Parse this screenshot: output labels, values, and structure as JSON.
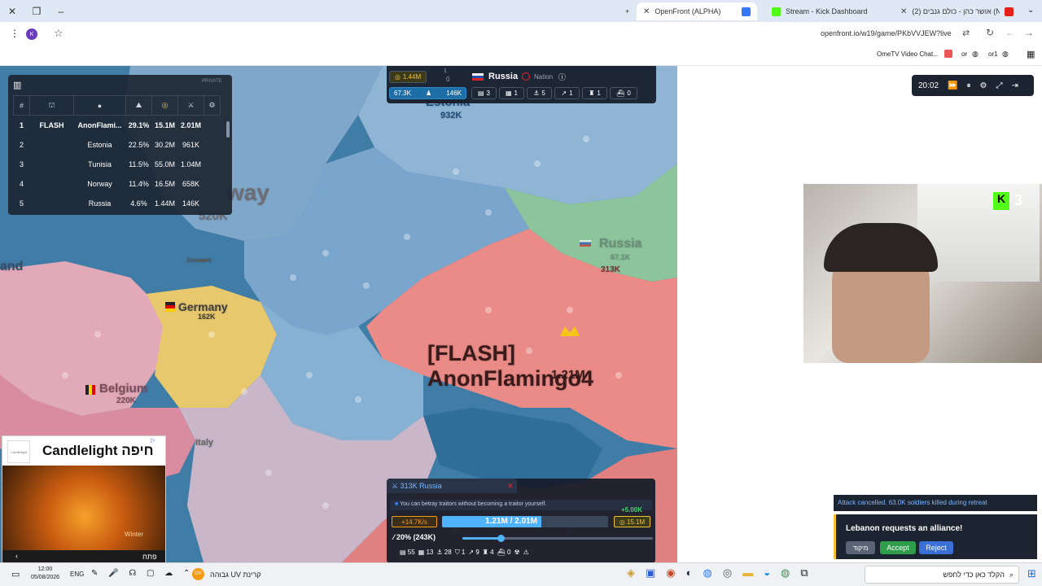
{
  "browser": {
    "tabs": [
      {
        "title": "OpenFront (ALPHA)",
        "active": true
      },
      {
        "title": "Stream - Kick Dashboard",
        "active": false
      },
      {
        "title": "(2) אושר כהן - כולם גנבים (Nuri)",
        "active": false
      }
    ],
    "url": "openfront.io/w19/game/PKbVVJEW?live",
    "bookmarks": [
      "OmeTV Video Chat...",
      "or",
      "or1"
    ]
  },
  "leaderboard": {
    "header_right": "PRIVATE",
    "columns": [
      "#",
      "",
      "",
      "",
      "",
      "",
      ""
    ],
    "rows": [
      {
        "rank": "1",
        "clan": "FLASH",
        "name": "AnonFlami...",
        "land": "29.1%",
        "gold": "15.1M",
        "troops": "2.01M"
      },
      {
        "rank": "2",
        "clan": "",
        "name": "Estonia",
        "land": "22.5%",
        "gold": "30.2M",
        "troops": "961K"
      },
      {
        "rank": "3",
        "clan": "",
        "name": "Tunisia",
        "land": "11.5%",
        "gold": "55.0M",
        "troops": "1.04M"
      },
      {
        "rank": "4",
        "clan": "",
        "name": "Norway",
        "land": "11.4%",
        "gold": "16.5M",
        "troops": "658K"
      },
      {
        "rank": "5",
        "clan": "",
        "name": "Russia",
        "land": "4.6%",
        "gold": "1.44M",
        "troops": "146K"
      }
    ]
  },
  "stats": {
    "gold": "1.44M",
    "troops_small": "1",
    "troops_small2": "0",
    "troops": "67.3K",
    "max_troops": "146K",
    "nation_name": "Russia",
    "nation_type": "Nation",
    "units": [
      "3",
      "1",
      "5",
      "1",
      "1",
      "0"
    ]
  },
  "map_labels": {
    "estonia": "Estonia",
    "estonia_troops": "932K",
    "norway": "way",
    "norway_troops": "520K",
    "russia": "Russia",
    "russia_troops_a": "67.1K",
    "russia_troops_b": "313K",
    "germany": "Germany",
    "germany_troops": "162K",
    "belgium": "Belgium",
    "belgium_troops": "220K",
    "italy": "Italy",
    "denmark": "Denmark",
    "player": "[FLASH] AnonFlamingo4",
    "player_troops": "1.21M",
    "land_left": "and"
  },
  "game_controls": {
    "time": "20:02"
  },
  "control_panel": {
    "attack_label": "313K Russia",
    "tip": "You can betray traitors without becoming a traitor yourself.",
    "income": "+5.00K",
    "troop_rate": "+14.7K/s",
    "troops_bar": "1.21M / 2.01M",
    "troops_fraction": 0.6,
    "gold": "15.1M",
    "attack_ratio": "20% (243K)",
    "slider_fraction": 0.2,
    "units": [
      "55",
      "13",
      "28",
      "1",
      "9",
      "4",
      "0",
      "",
      ""
    ]
  },
  "events": {
    "attack_cancelled": "Attack cancelled. 63.0K soldiers killed during retreat",
    "alliance_request": "Lebanon requests an alliance!",
    "focus_btn": "מיקוד",
    "accept_btn": "Accept",
    "reject_btn": "Reject"
  },
  "webcam": {
    "counter": "3"
  },
  "ad": {
    "title": "Candlelight חיפה",
    "brand": "Candlelight",
    "open_label": "פתח",
    "overlay_text": "Winter"
  },
  "taskbar": {
    "time": "12:00",
    "date": "05/08/2026",
    "lang": "ENG",
    "weather": "גבוהה UV קרינת",
    "search": "הקלד כאן כדי לחפש"
  },
  "colors": {
    "ocean": "#3f7ca6",
    "player_red": "#ea8b87",
    "estonia_blue": "#7fa7c9",
    "russia_green": "#8cc59c",
    "germany_yellow": "#e8c86d",
    "accept_green": "#2e9e4a",
    "reject_blue": "#3a6fd6",
    "accent_blue": "#4fb3ff"
  }
}
